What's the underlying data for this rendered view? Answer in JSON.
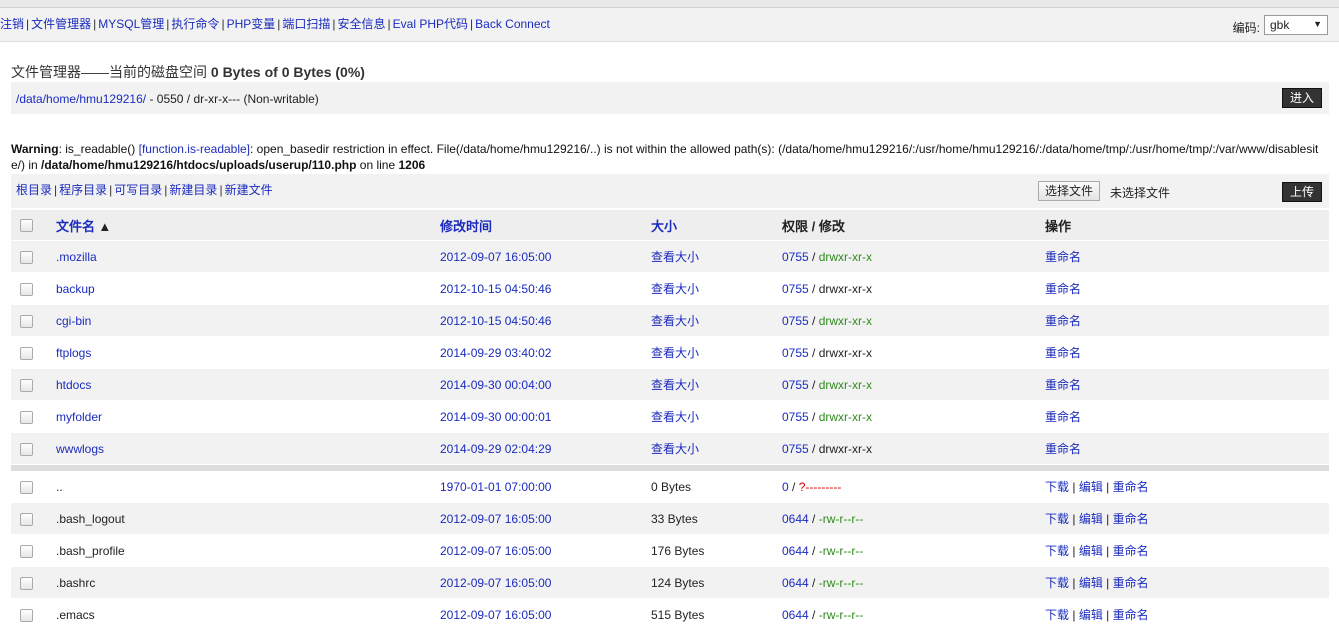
{
  "nav": {
    "items": [
      "注销",
      "文件管理器",
      "MYSQL管理",
      "执行命令",
      "PHP变量",
      "端口扫描",
      "安全信息",
      "Eval PHP代码",
      "Back Connect"
    ]
  },
  "encoding": {
    "label": "编码:",
    "value": "gbk",
    "arrow": "▼"
  },
  "heading": {
    "title": "文件管理器——当前的磁盘空间",
    "space": "0 Bytes of 0 Bytes (0%)"
  },
  "path": {
    "dir": "/data/home/hmu129216/",
    "perm": " - 0550 / dr-xr-x--- (Non-writable)",
    "go_label": "进入"
  },
  "warning": {
    "label": "Warning",
    "text1": ": is_readable() ",
    "func_link": "[function.is-readable]",
    "text2": ": open_basedir restriction in effect. File(/data/home/hmu129216/..) is not within the allowed path(s): (/data/home/hmu129216/:/usr/home/hmu129216/:/data/home/tmp/:/usr/home/tmp/:/var/www/disablesite/) in ",
    "file": "/data/home/hmu129216/htdocs/uploads/userup/110.php",
    "text3": " on line ",
    "line": "1206"
  },
  "toolbar": {
    "links": [
      "根目录",
      "程序目录",
      "可写目录",
      "新建目录",
      "新建文件"
    ],
    "choose_file": "选择文件",
    "no_file": "未选择文件",
    "upload_label": "上传"
  },
  "table": {
    "headers": {
      "name": "文件名",
      "sort_icon": "▲",
      "mtime": "修改时间",
      "size": "大小",
      "perm_a": "权限",
      "perm_sep": " / ",
      "perm_b": "修改",
      "ops": "操作"
    },
    "dirs": [
      {
        "name": ".mozilla",
        "mtime": "2012-09-07 16:05:00",
        "size": "查看大小",
        "mode": "0755",
        "perm": "drwxr-xr-x",
        "perm_color": "green",
        "op": "重命名"
      },
      {
        "name": "backup",
        "mtime": "2012-10-15 04:50:46",
        "size": "查看大小",
        "mode": "0755",
        "perm": "drwxr-xr-x",
        "perm_color": "dark",
        "op": "重命名"
      },
      {
        "name": "cgi-bin",
        "mtime": "2012-10-15 04:50:46",
        "size": "查看大小",
        "mode": "0755",
        "perm": "drwxr-xr-x",
        "perm_color": "green",
        "op": "重命名"
      },
      {
        "name": "ftplogs",
        "mtime": "2014-09-29 03:40:02",
        "size": "查看大小",
        "mode": "0755",
        "perm": "drwxr-xr-x",
        "perm_color": "dark",
        "op": "重命名"
      },
      {
        "name": "htdocs",
        "mtime": "2014-09-30 00:04:00",
        "size": "查看大小",
        "mode": "0755",
        "perm": "drwxr-xr-x",
        "perm_color": "green",
        "op": "重命名"
      },
      {
        "name": "myfolder",
        "mtime": "2014-09-30 00:00:01",
        "size": "查看大小",
        "mode": "0755",
        "perm": "drwxr-xr-x",
        "perm_color": "green",
        "op": "重命名"
      },
      {
        "name": "wwwlogs",
        "mtime": "2014-09-29 02:04:29",
        "size": "查看大小",
        "mode": "0755",
        "perm": "drwxr-xr-x",
        "perm_color": "dark",
        "op": "重命名"
      }
    ],
    "files": [
      {
        "name": "..",
        "mtime": "1970-01-01 07:00:00",
        "size": "0 Bytes",
        "mode": "0",
        "perm": "?---------",
        "perm_color": "red"
      },
      {
        "name": ".bash_logout",
        "mtime": "2012-09-07 16:05:00",
        "size": "33 Bytes",
        "mode": "0644",
        "perm": "-rw-r--r--",
        "perm_color": "green"
      },
      {
        "name": ".bash_profile",
        "mtime": "2012-09-07 16:05:00",
        "size": "176 Bytes",
        "mode": "0644",
        "perm": "-rw-r--r--",
        "perm_color": "green"
      },
      {
        "name": ".bashrc",
        "mtime": "2012-09-07 16:05:00",
        "size": "124 Bytes",
        "mode": "0644",
        "perm": "-rw-r--r--",
        "perm_color": "green"
      },
      {
        "name": ".emacs",
        "mtime": "2012-09-07 16:05:00",
        "size": "515 Bytes",
        "mode": "0644",
        "perm": "-rw-r--r--",
        "perm_color": "green"
      }
    ],
    "file_ops": [
      "下载",
      "编辑",
      "重命名"
    ]
  }
}
